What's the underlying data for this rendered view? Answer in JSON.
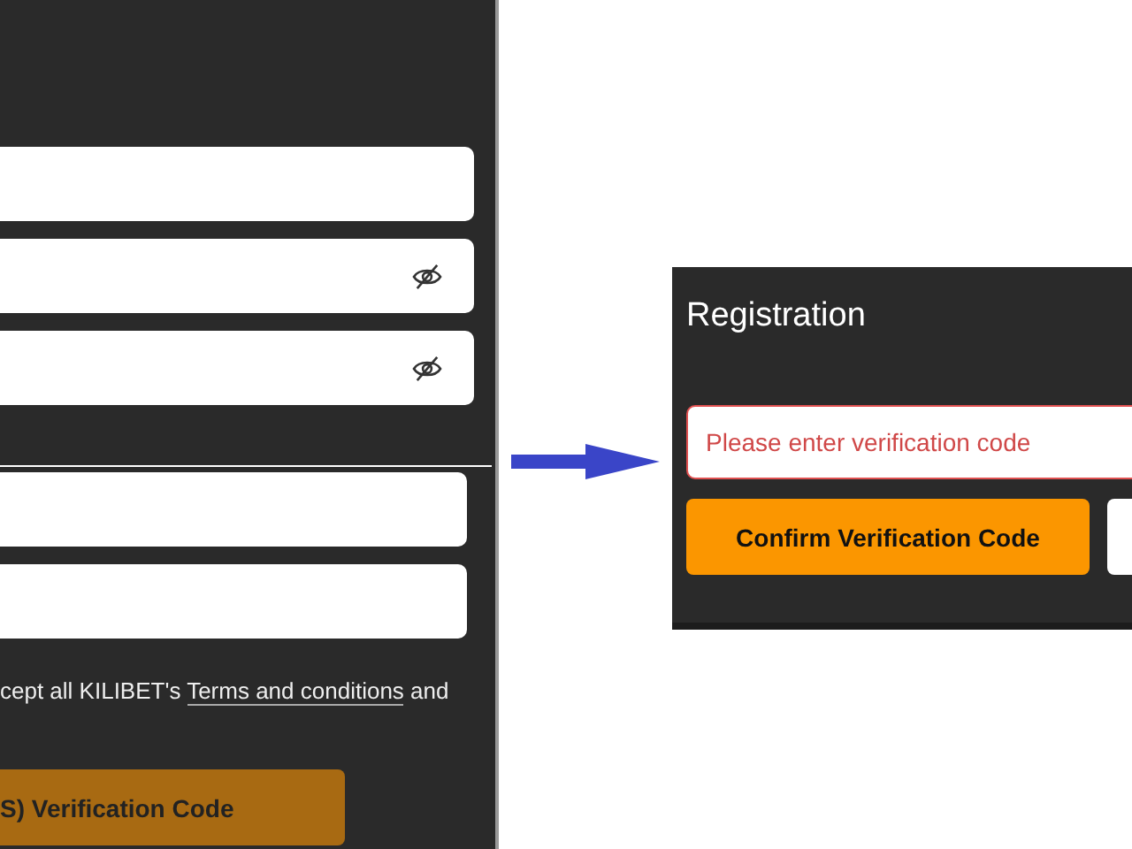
{
  "left_form": {
    "fields": [
      {
        "visibility_toggle": false
      },
      {
        "visibility_toggle": true
      },
      {
        "visibility_toggle": true
      }
    ],
    "lower_fields": [
      {
        "visibility_toggle": false
      },
      {
        "visibility_toggle": false
      }
    ],
    "terms": {
      "before": "cept all KILIBET's",
      "link": "Terms and conditions",
      "after": "and"
    },
    "submit_button": "S) Verification Code"
  },
  "dialog": {
    "title": "Registration",
    "code_field": {
      "placeholder": "Please enter verification code",
      "error": true
    },
    "confirm_button": "Confirm Verification Code"
  }
}
